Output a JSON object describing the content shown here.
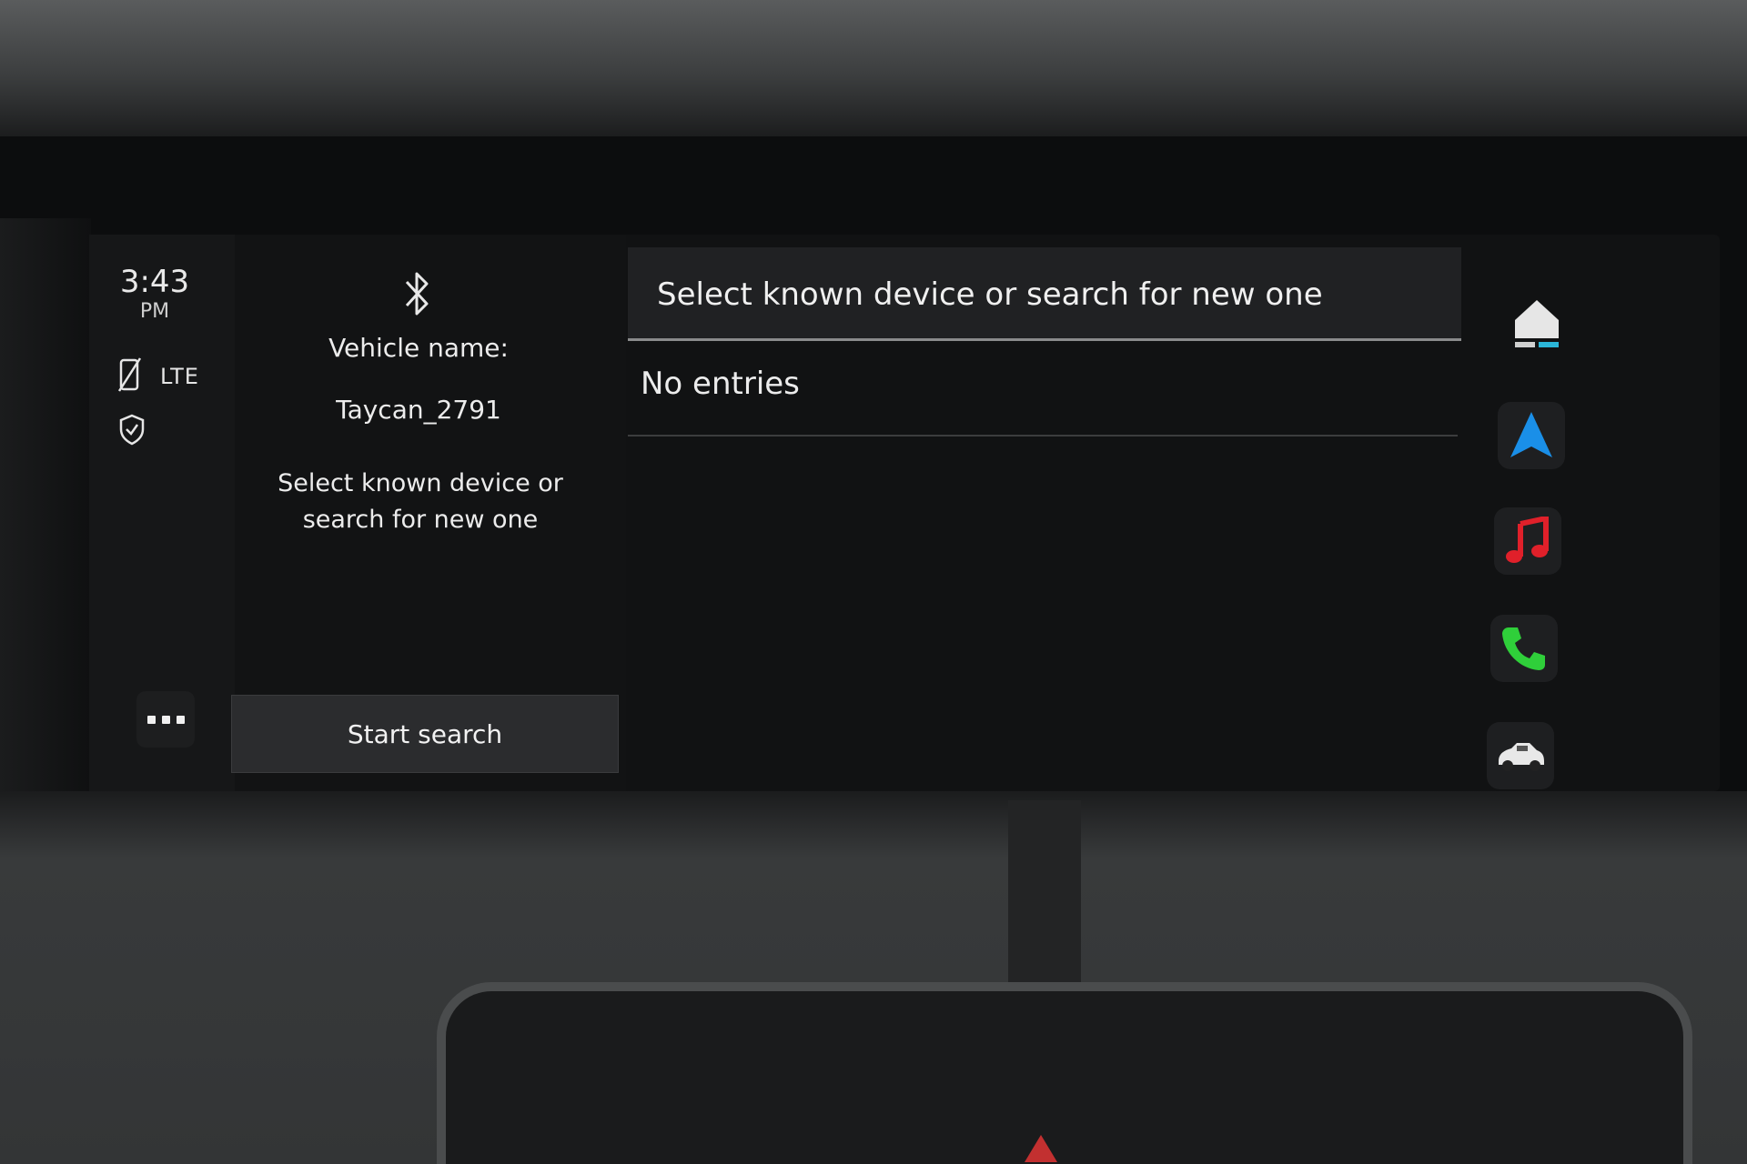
{
  "status": {
    "time": "3:43",
    "ampm": "PM",
    "network": "LTE"
  },
  "bluetooth": {
    "vehicle_label": "Vehicle name:",
    "vehicle_name": "Taycan_2791",
    "hint": "Select known device or search for new one",
    "start_search_label": "Start search"
  },
  "device_list": {
    "header": "Select known device or search for new one",
    "empty_text": "No entries"
  },
  "dock": {
    "items": [
      "home-icon",
      "navigation-icon",
      "music-icon",
      "phone-icon",
      "car-icon"
    ]
  },
  "colors": {
    "nav_blue": "#1a8fe8",
    "music_red": "#e0202a",
    "phone_green": "#2fcf3a",
    "home_accent": "#2bb6d8"
  }
}
